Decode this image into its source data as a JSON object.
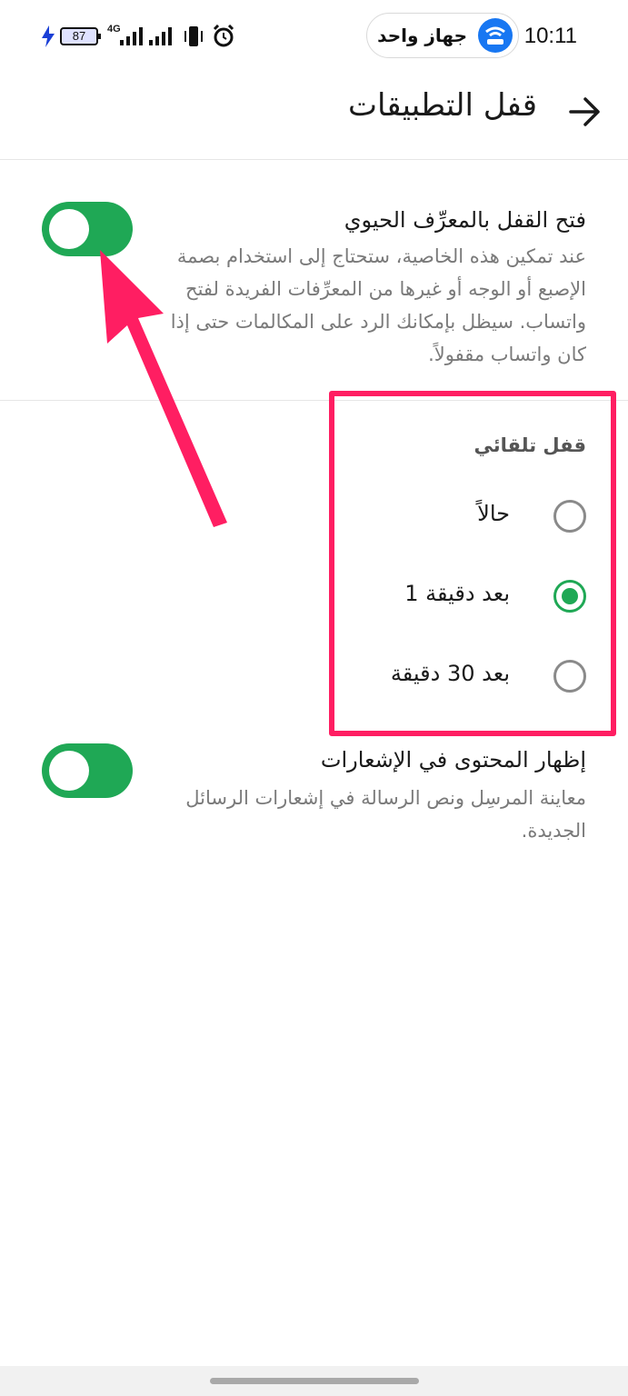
{
  "status_bar": {
    "time": "10:11",
    "pill_label": "جهاز واحد",
    "battery": "87",
    "network": "4G"
  },
  "header": {
    "title": "قفل التطبيقات"
  },
  "biometric": {
    "title": "فتح القفل بالمعرِّف الحيوي",
    "description": "عند تمكين هذه الخاصية، ستحتاج إلى استخدام بصمة الإصبع أو الوجه أو غيرها من المعرِّفات الفريدة لفتح واتساب. سيظل بإمكانك الرد على المكالمات حتى إذا كان واتساب مقفولاً.",
    "enabled": true
  },
  "auto_lock": {
    "label": "قفل تلقائي",
    "options": [
      {
        "label": "حالاً",
        "selected": false
      },
      {
        "label": "بعد دقيقة 1",
        "selected": true
      },
      {
        "label": "بعد 30 دقيقة",
        "selected": false
      }
    ]
  },
  "notifications": {
    "title": "إظهار المحتوى في الإشعارات",
    "description": "معاينة المرسِل ونص الرسالة في إشعارات الرسائل الجديدة.",
    "enabled": true
  },
  "colors": {
    "accent_green": "#1fa855",
    "annotation_pink": "#ff1e62"
  }
}
